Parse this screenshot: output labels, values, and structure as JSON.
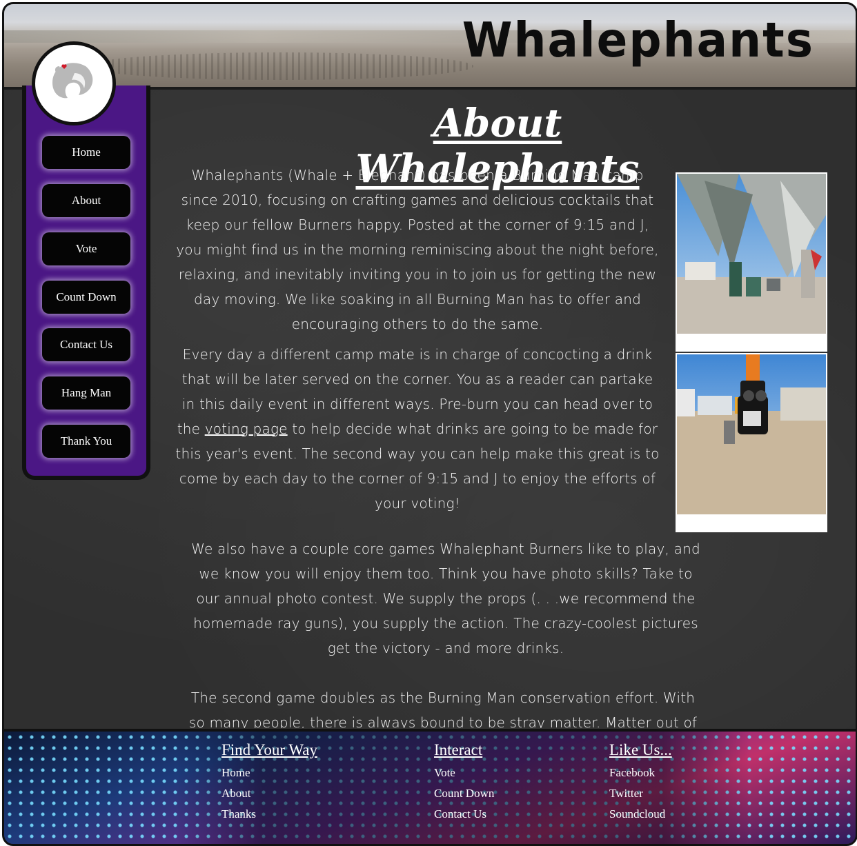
{
  "header": {
    "site_title": "Whalephants"
  },
  "sidebar": {
    "logo_icon": "whalephant-logo-icon",
    "items": [
      {
        "label": "Home"
      },
      {
        "label": "About"
      },
      {
        "label": "Vote"
      },
      {
        "label": "Count Down"
      },
      {
        "label": "Contact Us"
      },
      {
        "label": "Hang Man"
      },
      {
        "label": "Thank You"
      }
    ]
  },
  "main": {
    "title": "About Whalephants",
    "p1": "Whalephants (Whale + Elephant) has been a Burning Man camp since 2010, focusing on crafting games and delicious cocktails that keep our fellow Burners happy. Posted at the corner of 9:15 and J, you might find us in the morning reminiscing about the night before, relaxing, and inevitably inviting you in to join us for getting the new day moving. We like soaking in all Burning Man has to offer and encouraging others to do the same.",
    "p2_before": "Every day a different camp mate is in charge of concocting a drink that will be later served on the corner. You as a reader can partake in this daily event in different ways. Pre-burn you can head over to the ",
    "p2_link": "voting page",
    "p2_after": " to help decide what drinks are going to be made for this year's event. The second way you can help make this great is to come by each day to the corner of 9:15 and J to enjoy the efforts of your voting!",
    "p3": "We also have a couple core games Whalephant Burners like to play, and we know you will enjoy them too. Think you have photo skills? Take to our annual photo contest. We supply the props (. . .we recommend the homemade ray guns), you supply the action. The crazy-coolest pictures get the victory - and more drinks.",
    "p4": "The second game doubles as the Burning Man conservation effort. With so many people, there is always bound to be stray matter. Matter out of"
  },
  "footer": {
    "columns": [
      {
        "heading": "Find Your Way",
        "links": [
          "Home",
          "About",
          "Thanks"
        ]
      },
      {
        "heading": "Interact",
        "links": [
          "Vote",
          "Count Down",
          "Contact Us"
        ]
      },
      {
        "heading": "Like Us...",
        "links": [
          "Facebook",
          "Twitter",
          "Soundcloud"
        ]
      }
    ]
  }
}
